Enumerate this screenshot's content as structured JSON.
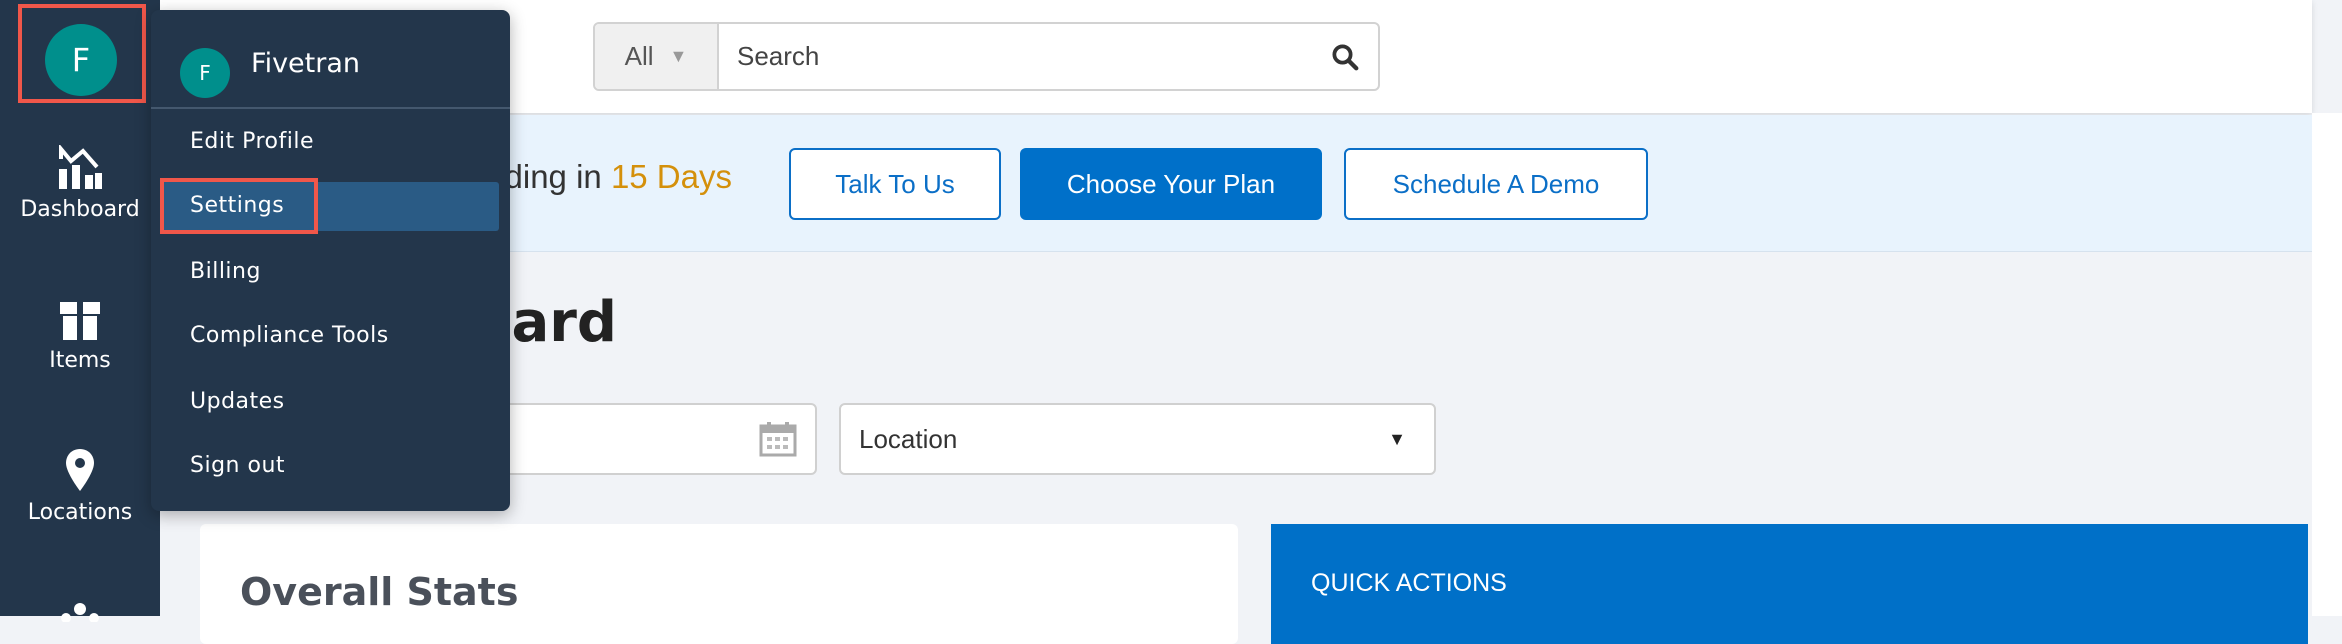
{
  "sidebar": {
    "avatar_initial": "F",
    "items": [
      {
        "label": "Dashboard",
        "icon": "chart-house-icon"
      },
      {
        "label": "Items",
        "icon": "gift-box-icon"
      },
      {
        "label": "Locations",
        "icon": "map-pin-icon"
      },
      {
        "label": "",
        "icon": "network-icon"
      }
    ]
  },
  "search": {
    "category": "All",
    "placeholder": "Search",
    "icon": "search-icon"
  },
  "banner": {
    "text": "Your trial is ending in",
    "days": "15 Days",
    "buttons": [
      "Talk To Us",
      "Choose Your Plan",
      "Schedule A Demo"
    ]
  },
  "page": {
    "title": "Dashboard"
  },
  "filters": {
    "location": "Location"
  },
  "cards": {
    "overall_stats": "Overall Stats",
    "quick_actions": "QUICK ACTIONS"
  },
  "menu": {
    "avatar_initial": "F",
    "name": "Fivetran",
    "items": [
      "Edit Profile",
      "Settings",
      "Billing",
      "Compliance Tools",
      "Updates",
      "Sign out"
    ],
    "active": "Settings"
  },
  "colors": {
    "sidebar": "#23364b",
    "accent": "#0070c9",
    "highlight": "#f0574a",
    "days": "#d4900b",
    "avatar": "#008f8c"
  }
}
